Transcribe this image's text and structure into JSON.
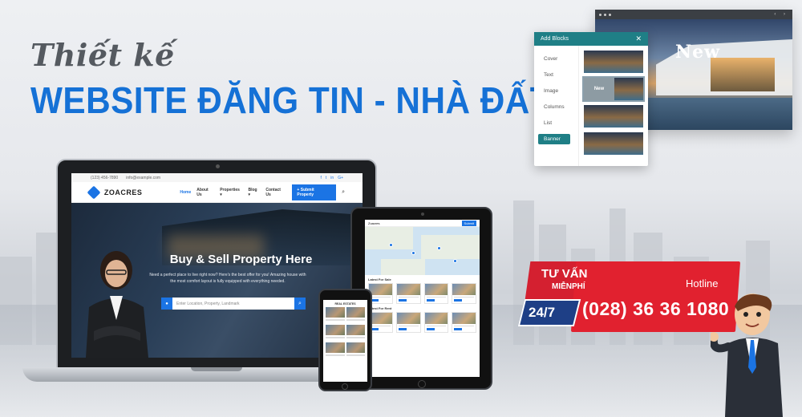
{
  "headline": {
    "line1": "Thiết kế",
    "line2": "WEBSITE ĐĂNG TIN - NHÀ ĐẤT"
  },
  "laptop_site": {
    "topbar_phone": "(123) 456-7890",
    "topbar_email": "info@example.com",
    "social": [
      "f",
      "t",
      "in",
      "G+"
    ],
    "logo": "ZOACRES",
    "nav": [
      "Home",
      "About Us",
      "Properties ▾",
      "Blog ▾",
      "Contact Us"
    ],
    "submit_label": "+ Submit Property",
    "hero_title": "Buy & Sell Property Here",
    "hero_subtitle": "Need a perfect place to live right now? Here's the best offer for you! Amazing house with the most comfort layout is fully equipped with everything needed.",
    "search_placeholder": "Enter Location, Property, Landmark"
  },
  "tablet_site": {
    "logo": "Zoacres",
    "button": "Submit",
    "section_latest": "Latest For Sale",
    "section_rent": "Latest For Rent"
  },
  "phone_site": {
    "title": "REAL ESTATES"
  },
  "blocks_panel": {
    "title": "Add Blocks",
    "close": "✕",
    "items": [
      "Cover",
      "Text",
      "Image",
      "Columns",
      "List",
      "Banner"
    ],
    "active_item": "Banner",
    "thumb_new_label": "New"
  },
  "browser_preview": {
    "nav_glyphs": "‹ ›",
    "badge": "New"
  },
  "consult": {
    "line1": "TƯ VẤN",
    "line2": "MIỄNPHÍ",
    "hotline_label": "Hotline",
    "availability": "24/7",
    "phone": "(028) 36 36 1080"
  },
  "colors": {
    "brand_blue": "#1571d6",
    "teal": "#1f7f86",
    "red": "#e1212f",
    "navy": "#1e3f86"
  }
}
